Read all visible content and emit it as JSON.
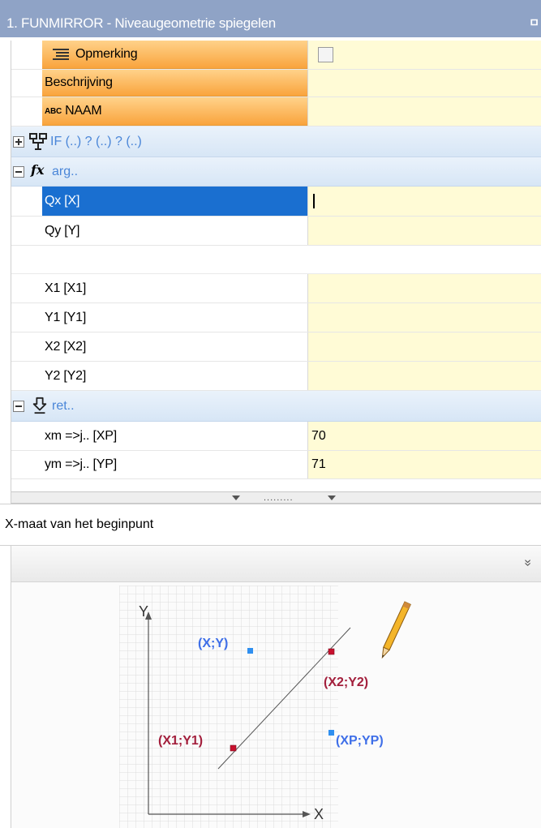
{
  "window": {
    "title": "1. FUNMIRROR - Niveaugeometrie spiegelen",
    "pin_glyph": "ㅁ"
  },
  "rows": {
    "opmerking": {
      "label": "Opmerking",
      "icon": "list-icon",
      "value_type": "checkbox",
      "checked": false
    },
    "beschrijving": {
      "label": "Beschrijving",
      "value": ""
    },
    "naam": {
      "label": "NAAM",
      "icon_text": "ABC",
      "value": ""
    },
    "if_section": {
      "label": "IF (..) ? (..) ? (..)",
      "icon": "flowchart-icon",
      "expanded": false
    },
    "arg_section": {
      "label": "arg..",
      "icon_text": "fx",
      "expanded": true
    },
    "qx": {
      "label": "Qx [X]",
      "value": ""
    },
    "qy": {
      "label": "Qy [Y]",
      "value": ""
    },
    "x1": {
      "label": "X1 [X1]",
      "value": ""
    },
    "y1": {
      "label": "Y1 [Y1]",
      "value": ""
    },
    "x2": {
      "label": "X2 [X2]",
      "value": ""
    },
    "y2": {
      "label": "Y2 [Y2]",
      "value": ""
    },
    "ret_section": {
      "label": "ret..",
      "icon": "return-arrow-icon",
      "expanded": true
    },
    "xm": {
      "label": "xm =>j.. [XP]",
      "value": "70"
    },
    "ym": {
      "label": "ym =>j.. [YP]",
      "value": "71"
    }
  },
  "splitter": {
    "dots": "........."
  },
  "description": "X-maat van het beginpunt",
  "toolbar2": {
    "collapse_glyph": "»"
  },
  "diagram": {
    "axis_y": "Y",
    "axis_x": "X",
    "point_xy": "(X;Y)",
    "point_x2y2": "(X2;Y2)",
    "point_x1y1": "(X1;Y1)",
    "point_xpyp": "(XP;YP)",
    "colors": {
      "blue": "#3f6fe8",
      "red": "#a31f3c",
      "grid": "#d8d8d8"
    }
  }
}
